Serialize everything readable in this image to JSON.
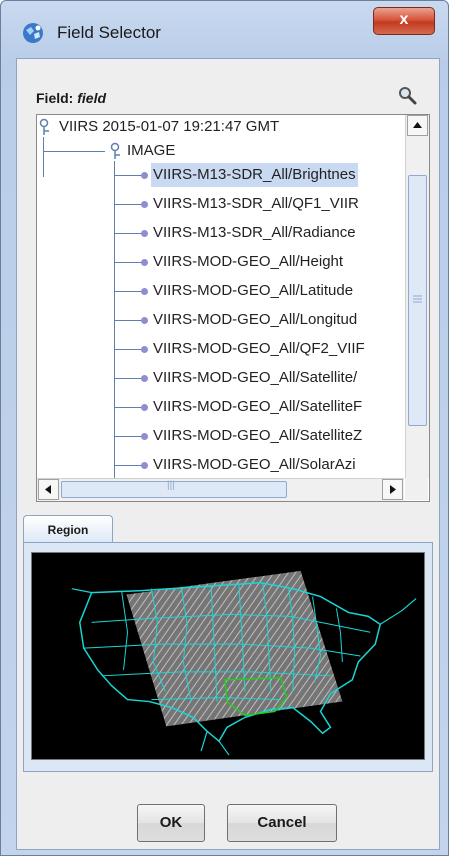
{
  "window": {
    "title": "Field Selector",
    "close_label": "x",
    "app_icon": "app-icon"
  },
  "field": {
    "label_prefix": "Field: ",
    "label_value": "field",
    "search_icon": "magnifier-icon"
  },
  "tree": {
    "root": "VIIRS 2015-01-07 19:21:47 GMT",
    "group": "IMAGE",
    "items": [
      "VIIRS-M13-SDR_All/Brightnes",
      "VIIRS-M13-SDR_All/QF1_VIIR",
      "VIIRS-M13-SDR_All/Radiance",
      "VIIRS-MOD-GEO_All/Height",
      "VIIRS-MOD-GEO_All/Latitude",
      "VIIRS-MOD-GEO_All/Longitud",
      "VIIRS-MOD-GEO_All/QF2_VIIF",
      "VIIRS-MOD-GEO_All/Satellite/",
      "VIIRS-MOD-GEO_All/SatelliteF",
      "VIIRS-MOD-GEO_All/SatelliteZ",
      "VIIRS-MOD-GEO_All/SolarAzi"
    ],
    "selected_index": 0,
    "hscroll_grip": "|||"
  },
  "region": {
    "tab_label": "Region",
    "map_colors": {
      "background": "#000000",
      "outline": "#19d6d6",
      "highlight": "#22cc22"
    }
  },
  "buttons": {
    "ok": "OK",
    "cancel": "Cancel"
  }
}
